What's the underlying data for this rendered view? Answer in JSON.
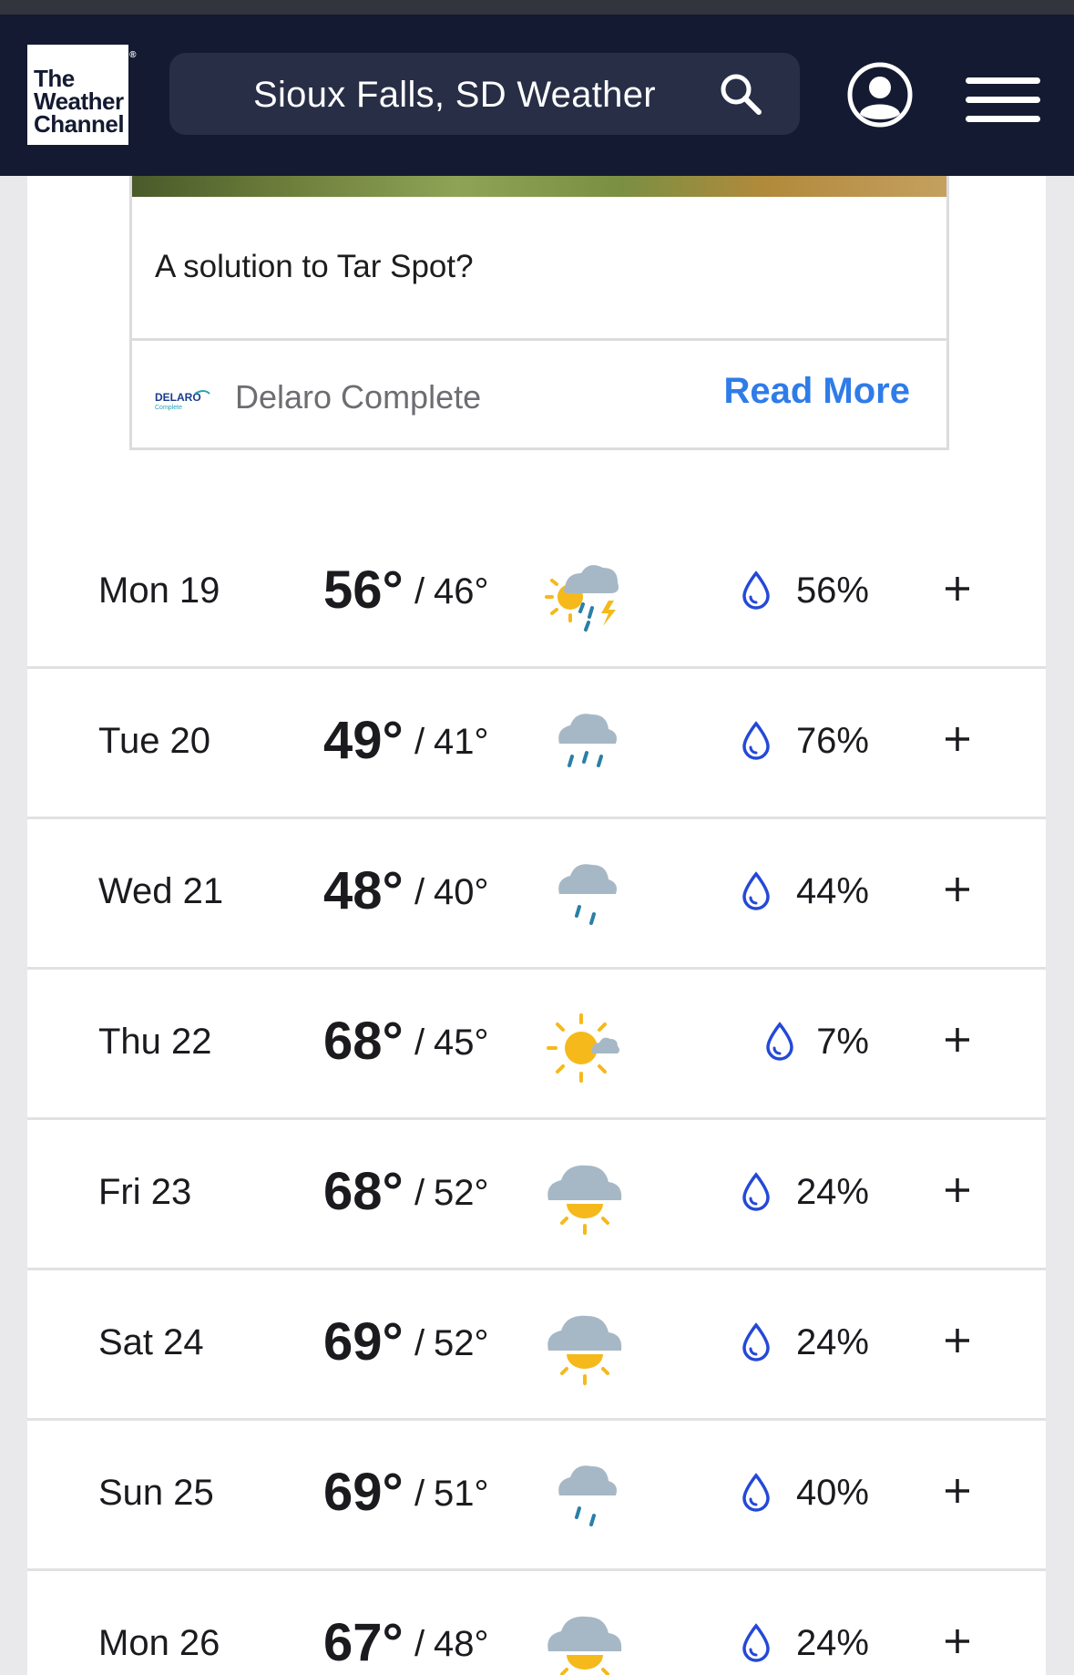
{
  "header": {
    "logo_line1": "The",
    "logo_line2": "Weather",
    "logo_line3": "Channel",
    "logo_reg": "®",
    "search_text": "Sioux Falls, SD Weather",
    "search_icon": "search-icon",
    "account_icon": "user-account-icon",
    "menu_icon": "hamburger-menu-icon"
  },
  "ad": {
    "title": "A solution to Tar Spot?",
    "brand_logo_text": "DELARO",
    "brand_logo_sub": "Complete",
    "brand": "Delaro Complete",
    "cta": "Read More"
  },
  "forecast": [
    {
      "day": "Mon 19",
      "high": "56°",
      "low": "46°",
      "icon": "scattered-thunderstorms-icon",
      "precip": "56%"
    },
    {
      "day": "Tue 20",
      "high": "49°",
      "low": "41°",
      "icon": "rain-icon",
      "precip": "76%"
    },
    {
      "day": "Wed 21",
      "high": "48°",
      "low": "40°",
      "icon": "showers-icon",
      "precip": "44%"
    },
    {
      "day": "Thu 22",
      "high": "68°",
      "low": "45°",
      "icon": "mostly-sunny-icon",
      "precip": "7%"
    },
    {
      "day": "Fri 23",
      "high": "68°",
      "low": "52°",
      "icon": "partly-cloudy-icon",
      "precip": "24%"
    },
    {
      "day": "Sat 24",
      "high": "69°",
      "low": "52°",
      "icon": "partly-cloudy-icon",
      "precip": "24%"
    },
    {
      "day": "Sun 25",
      "high": "69°",
      "low": "51°",
      "icon": "showers-icon",
      "precip": "40%"
    },
    {
      "day": "Mon 26",
      "high": "67°",
      "low": "48°",
      "icon": "partly-cloudy-icon",
      "precip": "24%"
    }
  ],
  "colors": {
    "header_bg": "#141a31",
    "search_bg": "#272e46",
    "link_blue": "#2f7ce8",
    "drop_blue": "#2448d8",
    "sun_yellow": "#f5b91c",
    "cloud_gray": "#a6b8c6",
    "rain_blue": "#2a7fa8"
  }
}
